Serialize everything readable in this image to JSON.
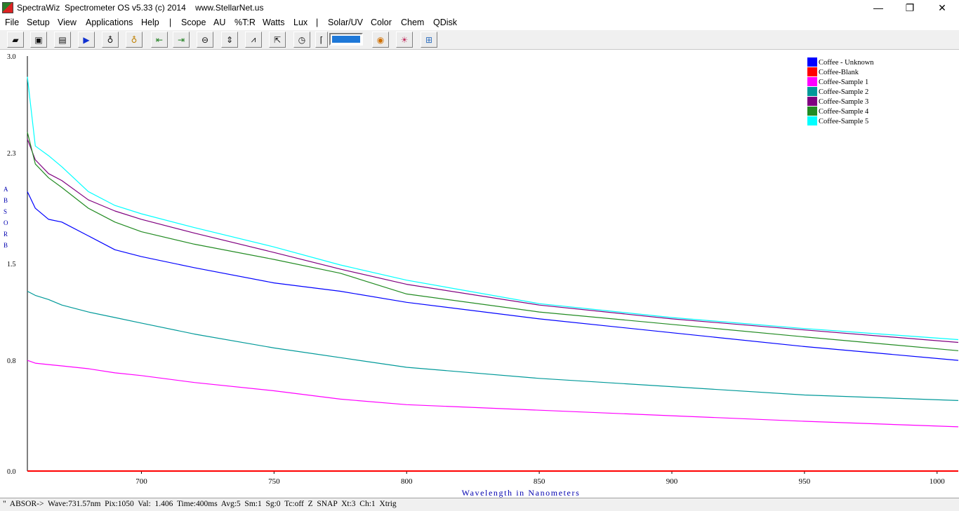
{
  "window": {
    "title": "SpectraWiz  Spectrometer OS v5.33 (c) 2014    www.StellarNet.us",
    "minimize": "—",
    "maximize": "❐",
    "close": "✕"
  },
  "menu": [
    "File",
    "Setup",
    "View",
    "Applications",
    "Help",
    "|",
    "Scope",
    "AU",
    "%T:R",
    "Watts",
    "Lux",
    "|",
    "Solar/UV",
    "Color",
    "Chem",
    "QDisk"
  ],
  "toolbar": {
    "buttons": [
      {
        "name": "camera-icon",
        "glyph": "▰"
      },
      {
        "name": "save-icon",
        "glyph": "▣"
      },
      {
        "name": "printer-icon",
        "glyph": "▤"
      },
      {
        "name": "play-icon",
        "glyph": "▶"
      },
      {
        "name": "lamp-dark-icon",
        "glyph": "♁"
      },
      {
        "name": "lamp-light-icon",
        "glyph": "♁"
      },
      {
        "name": "cursor-left-icon",
        "glyph": "⇤"
      },
      {
        "name": "cursor-right-icon",
        "glyph": "⇥"
      },
      {
        "name": "zoom-icon",
        "glyph": "⊖"
      },
      {
        "name": "scale-y-icon",
        "glyph": "⇕"
      },
      {
        "name": "peak-icon",
        "glyph": "⩘"
      },
      {
        "name": "autoscale-icon",
        "glyph": "⇱"
      },
      {
        "name": "clock-icon",
        "glyph": "◷"
      },
      {
        "name": "bracket-icon",
        "glyph": "⌈"
      },
      {
        "name": "color-wheel-icon",
        "glyph": "◉"
      },
      {
        "name": "sun-icon",
        "glyph": "☀"
      },
      {
        "name": "chart-export-icon",
        "glyph": "⊞"
      }
    ]
  },
  "status": "\"  ABSOR->  Wave:731.57nm  Pix:1050  Val:  1.406  Time:400ms  Avg:5  Sm:1  Sg:0  Tc:off  Z  SNAP  Xt:3  Ch:1  Xtrig",
  "chart_data": {
    "type": "line",
    "xlabel": "Wavelength in Nanometers",
    "ylabel": "ABSORB",
    "xlim": [
      657,
      1008
    ],
    "ylim": [
      0,
      3.0
    ],
    "xticks": [
      700,
      750,
      800,
      850,
      900,
      950,
      1000
    ],
    "yticks": [
      0.0,
      0.8,
      1.5,
      2.3,
      3.0
    ],
    "ytick_labels": [
      "0.0",
      "0.8",
      "1.5",
      "2.3",
      "3.0"
    ],
    "grid": false,
    "legend_position": "top-right",
    "x": [
      657,
      660,
      665,
      670,
      680,
      690,
      700,
      720,
      750,
      775,
      800,
      850,
      900,
      950,
      1008
    ],
    "series": [
      {
        "name": "Coffee - Unknown",
        "color": "#0000ff",
        "values": [
          2.02,
          1.9,
          1.82,
          1.8,
          1.7,
          1.6,
          1.55,
          1.47,
          1.36,
          1.3,
          1.22,
          1.1,
          1.0,
          0.9,
          0.8
        ]
      },
      {
        "name": "Coffee-Blank",
        "color": "#ff0000",
        "values": [
          0.0,
          0.0,
          0.0,
          0.0,
          0.0,
          0.0,
          0.0,
          0.0,
          0.0,
          0.0,
          0.0,
          0.0,
          0.0,
          0.0,
          0.0
        ]
      },
      {
        "name": "Coffee-Sample 1",
        "color": "#ff00ff",
        "values": [
          0.8,
          0.78,
          0.77,
          0.76,
          0.74,
          0.71,
          0.69,
          0.64,
          0.58,
          0.52,
          0.48,
          0.44,
          0.4,
          0.36,
          0.32
        ]
      },
      {
        "name": "Coffee-Sample 2",
        "color": "#009999",
        "values": [
          1.3,
          1.27,
          1.24,
          1.2,
          1.15,
          1.11,
          1.07,
          0.99,
          0.89,
          0.82,
          0.75,
          0.67,
          0.61,
          0.55,
          0.51
        ]
      },
      {
        "name": "Coffee-Sample 3",
        "color": "#800080",
        "values": [
          2.4,
          2.25,
          2.15,
          2.1,
          1.96,
          1.88,
          1.82,
          1.72,
          1.58,
          1.46,
          1.35,
          1.2,
          1.1,
          1.02,
          0.93
        ]
      },
      {
        "name": "Coffee-Sample 4",
        "color": "#228b22",
        "values": [
          2.45,
          2.22,
          2.12,
          2.05,
          1.9,
          1.8,
          1.73,
          1.64,
          1.53,
          1.43,
          1.28,
          1.15,
          1.06,
          0.97,
          0.87
        ]
      },
      {
        "name": "Coffee-Sample 5",
        "color": "#00ffff",
        "values": [
          2.85,
          2.35,
          2.28,
          2.2,
          2.02,
          1.92,
          1.86,
          1.76,
          1.62,
          1.49,
          1.38,
          1.21,
          1.11,
          1.03,
          0.95
        ]
      }
    ]
  }
}
